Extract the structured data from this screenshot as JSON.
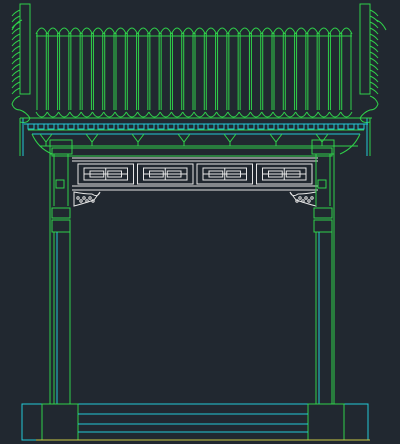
{
  "drawing": {
    "background": "#212830",
    "colors": {
      "primary": "#2fd14a",
      "secondary": "#22c9d6",
      "accent": "#e6e6e6",
      "yellow": "#c9c944"
    },
    "roof_tile_count": 28,
    "lattice_panel_count": 4
  }
}
